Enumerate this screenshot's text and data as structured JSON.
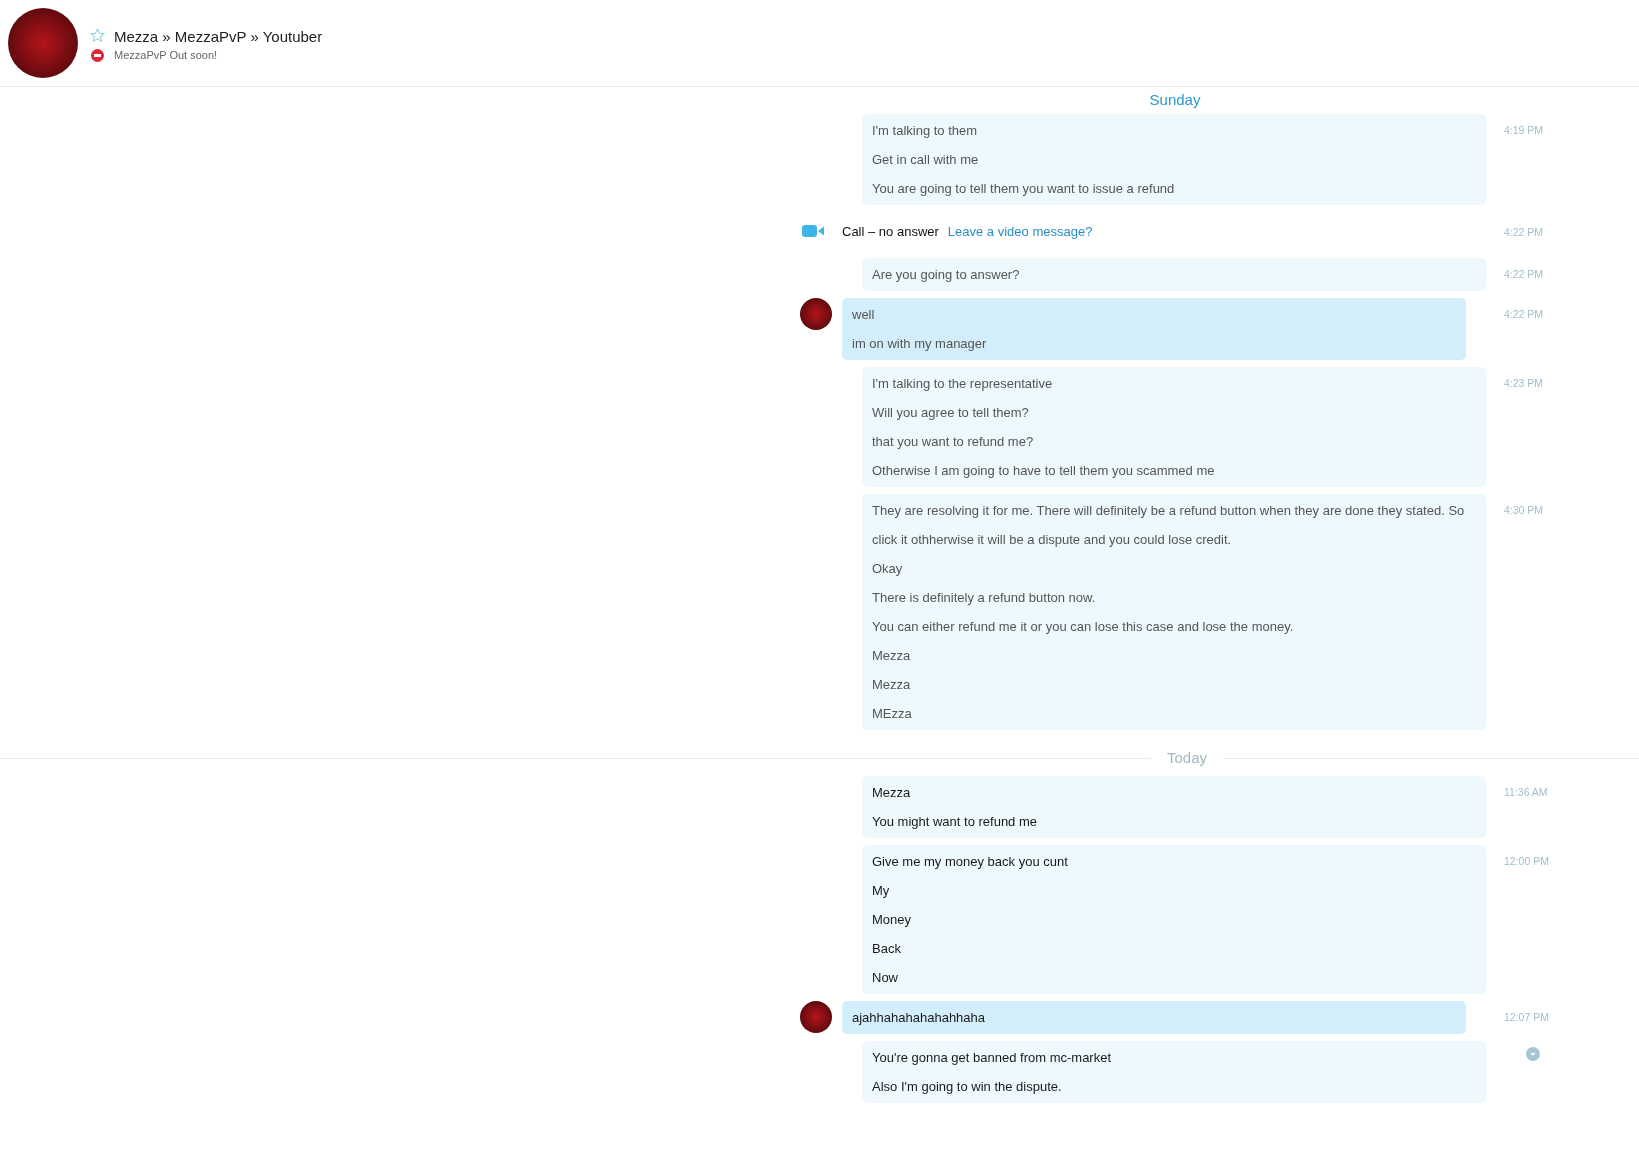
{
  "header": {
    "title": "Mezza » MezzaPvP » Youtuber",
    "favorite": false,
    "busy": true,
    "mood": "MezzaPvP Out soon!"
  },
  "days": [
    {
      "label": "Sunday",
      "ruled": false,
      "groups": [
        {
          "kind": "outgoing",
          "dimmed": true,
          "time": "4:19 PM",
          "lines": [
            "I'm talking to them",
            "Get in call with me",
            "You are going to tell them you want to issue a refund"
          ]
        },
        {
          "kind": "call",
          "time": "4:22 PM",
          "text": "Call – no answer",
          "link": "Leave a video message?"
        },
        {
          "kind": "outgoing",
          "dimmed": true,
          "time": "4:22 PM",
          "lines": [
            "Are you going to answer?"
          ]
        },
        {
          "kind": "incoming",
          "dimmed": true,
          "time": "4:22 PM",
          "lines": [
            "well",
            "im on with my manager"
          ]
        },
        {
          "kind": "outgoing",
          "dimmed": true,
          "time": "4:23 PM",
          "lines": [
            "I'm talking to the representative",
            "Will you agree to tell them?",
            "that you want to refund me?",
            "Otherwise I am going to have to tell them you scammed me"
          ]
        },
        {
          "kind": "outgoing",
          "dimmed": true,
          "time": "4:30 PM",
          "lines": [
            "They are resolving it for me. There will definitely be a refund button when they are done they stated. So click it othherwise it will be a dispute and you could lose credit.",
            "Okay",
            "There is definitely a refund button now.",
            "You can either refund me it or you can lose this case and lose the money.",
            "Mezza",
            "Mezza",
            "MEzza"
          ]
        }
      ]
    },
    {
      "label": "Today",
      "ruled": true,
      "groups": [
        {
          "kind": "outgoing",
          "dimmed": false,
          "time": "11:36 AM",
          "lines": [
            "Mezza",
            "You might want to refund me"
          ]
        },
        {
          "kind": "outgoing",
          "dimmed": false,
          "time": "12:00 PM",
          "lines": [
            "Give me my money back you cunt",
            "My",
            "Money",
            "Back",
            "Now"
          ]
        },
        {
          "kind": "incoming",
          "dimmed": false,
          "time": "12:07 PM",
          "lines": [
            "ajahhahahahahahhaha"
          ]
        },
        {
          "kind": "outgoing",
          "dimmed": false,
          "sending": true,
          "lines": [
            "You're gonna get banned from mc-market",
            "Also I'm going to win the dispute."
          ]
        }
      ]
    }
  ]
}
